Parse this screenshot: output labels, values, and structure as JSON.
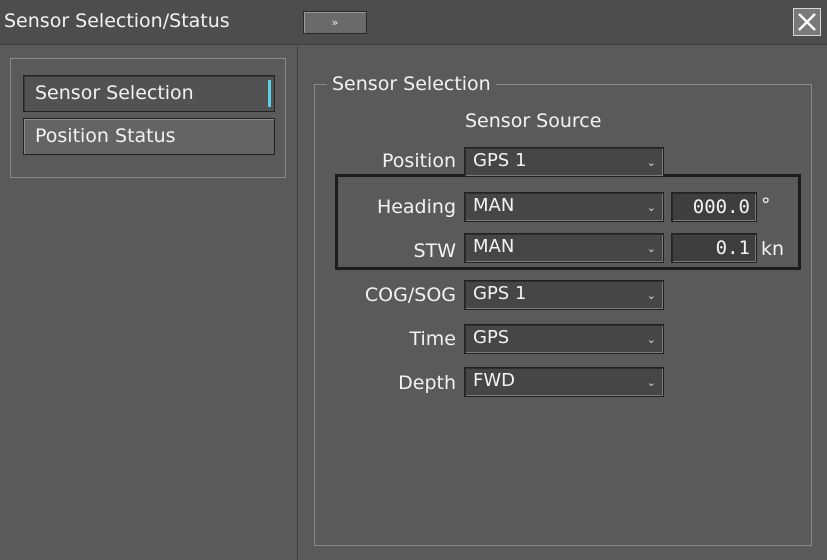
{
  "window": {
    "title": "Sensor Selection/Status",
    "expand_icon": "»",
    "close_icon": "close-x"
  },
  "nav": {
    "items": [
      {
        "label": "Sensor Selection",
        "active": true
      },
      {
        "label": "Position Status",
        "active": false
      }
    ]
  },
  "group": {
    "title": "Sensor Selection",
    "column_header": "Sensor Source",
    "rows": [
      {
        "label": "Position",
        "value": "GPS 1"
      },
      {
        "label": "Heading",
        "value": "MAN",
        "manual_value": "000.0",
        "unit": "°"
      },
      {
        "label": "STW",
        "value": "MAN",
        "manual_value": "0.1",
        "unit": "kn"
      },
      {
        "label": "COG/SOG",
        "value": "GPS 1"
      },
      {
        "label": "Time",
        "value": "GPS"
      },
      {
        "label": "Depth",
        "value": "FWD"
      }
    ]
  },
  "colors": {
    "background": "#5a5a5a",
    "active_indicator": "#5ed0e8",
    "text": "#f2f2f2"
  }
}
